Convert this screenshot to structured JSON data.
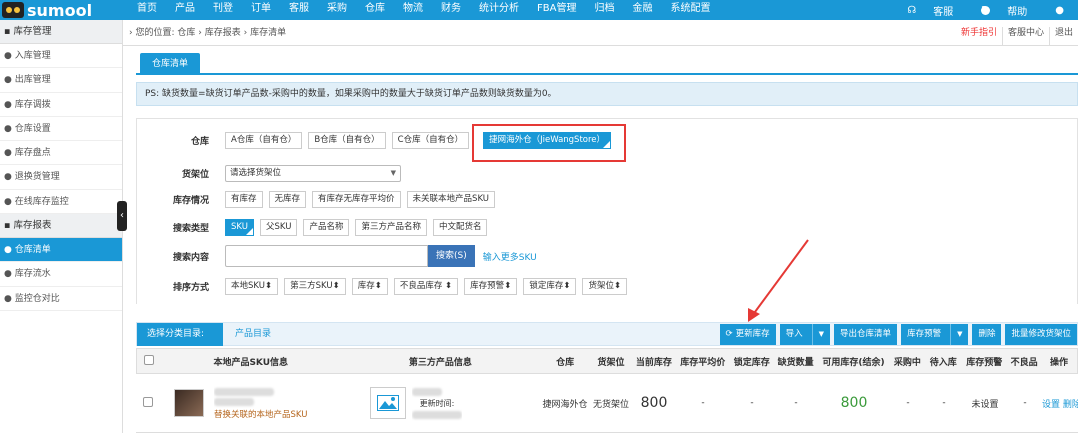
{
  "brand": {
    "logo_text": "sumool"
  },
  "topnav": {
    "items": [
      "首页",
      "产品",
      "刊登",
      "订单",
      "客服",
      "采购",
      "仓库",
      "物流",
      "财务",
      "统计分析",
      "FBA管理",
      "归档",
      "金融",
      "系统配置"
    ],
    "right": {
      "service": "客服",
      "help": "帮助"
    }
  },
  "sidebar": {
    "sections": [
      {
        "title": "库存管理",
        "items": [
          "入库管理",
          "出库管理",
          "库存调拨",
          "仓库设置",
          "库存盘点",
          "退换货管理",
          "在线库存监控"
        ]
      },
      {
        "title": "库存报表",
        "items": [
          "仓库清单",
          "库存流水",
          "监控仓对比"
        ]
      }
    ],
    "active": "仓库清单"
  },
  "breadcrumb": {
    "prefix": "您的位置:",
    "path": [
      "仓库",
      "库存报表",
      "库存清单"
    ],
    "right": {
      "guide": "新手指引",
      "center": "客服中心",
      "exit": "退出"
    }
  },
  "tab": {
    "label": "仓库清单"
  },
  "ps_note": "PS: 缺货数量=缺货订单产品数-采购中的数量，如果采购中的数量大于缺货订单产品数则缺货数量为0。",
  "filters": {
    "warehouse": {
      "label": "仓库",
      "options": [
        "A仓库（自有仓）",
        "B仓库（自有仓）",
        "C仓库（自有仓）",
        "捷网海外仓（JieWangStore）"
      ],
      "selected": "捷网海外仓（JieWangStore）"
    },
    "shelf": {
      "label": "货架位",
      "value": "请选择货架位"
    },
    "stock": {
      "label": "库存情况",
      "options": [
        "有库存",
        "无库存",
        "有库存无库存平均价",
        "未关联本地产品SKU"
      ]
    },
    "search_type": {
      "label": "搜索类型",
      "options": [
        "SKU",
        "父SKU",
        "产品名称",
        "第三方产品名称",
        "中文配货名"
      ],
      "selected": "SKU"
    },
    "search": {
      "label": "搜索内容",
      "value": "",
      "button": "搜索(S)",
      "more_link": "输入更多SKU"
    },
    "sort": {
      "label": "排序方式",
      "options": [
        "本地SKU",
        "第三方SKU",
        "库存",
        "不良品库存",
        "库存预警",
        "锁定库存",
        "货架位"
      ],
      "arrow": "⬍"
    }
  },
  "table": {
    "category_label": "选择分类目录:",
    "category_value": "产品目录",
    "buttons": {
      "refresh": "更新库存",
      "import": "导入",
      "export": "导出仓库清单",
      "warning": "库存预警",
      "delete": "删除",
      "batch": "批量修改货架位"
    },
    "headers": [
      "本地产品SKU信息",
      "第三方产品信息",
      "仓库",
      "货架位",
      "当前库存",
      "库存平均价",
      "锁定库存",
      "缺货数量",
      "可用库存(结余)",
      "采购中",
      "待入库",
      "库存预警",
      "不良品",
      "操作"
    ],
    "rows": [
      {
        "local_link": "替换关联的本地产品SKU",
        "third_update": "更新时间:",
        "warehouse": "捷网海外仓",
        "shelf": "无货架位",
        "current": "800",
        "avg_price": "-",
        "locked": "-",
        "short": "-",
        "available": "800",
        "purchasing": "-",
        "pending": "-",
        "warning": "未设置",
        "defective": "-",
        "ops": "设置 删除"
      }
    ]
  }
}
